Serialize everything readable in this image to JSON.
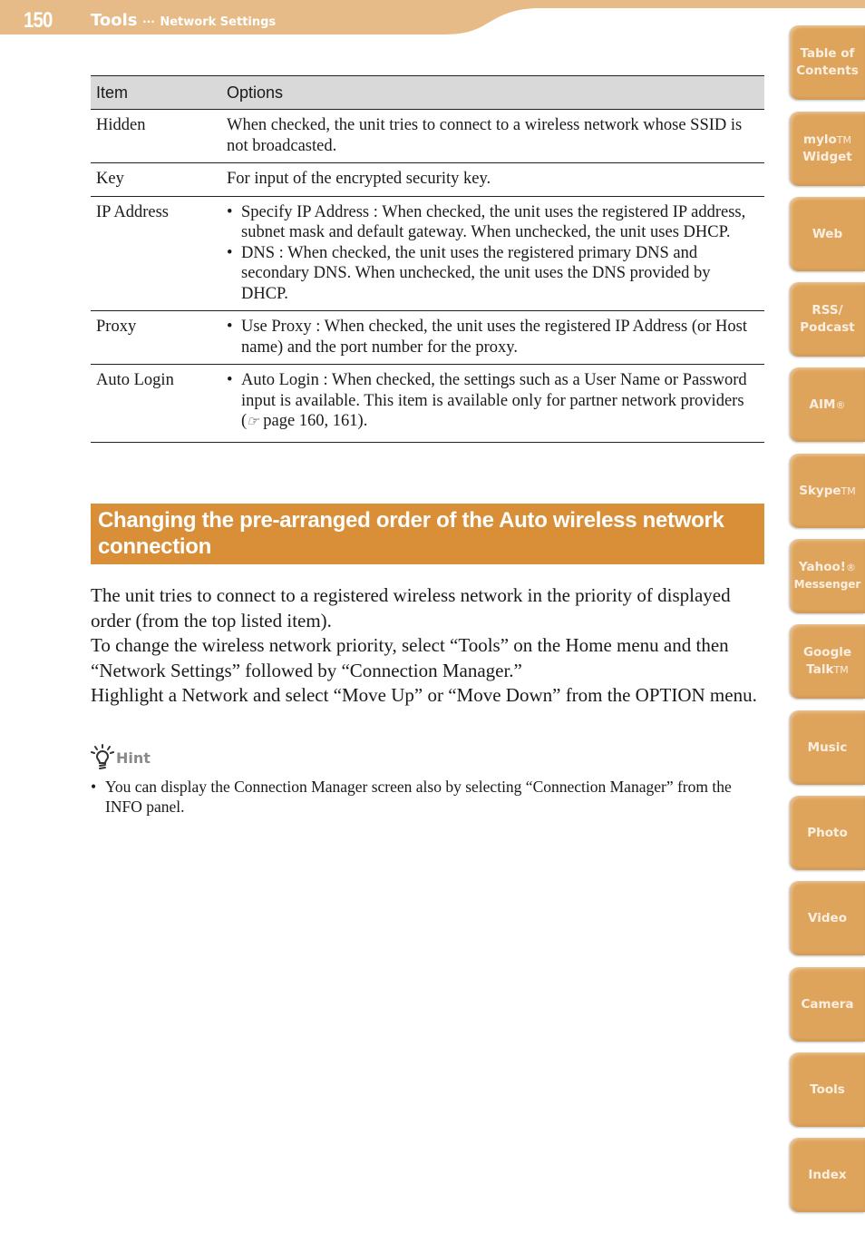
{
  "header": {
    "page_number": "150",
    "section": "Tools",
    "separator": "···",
    "subsection": "Network Settings"
  },
  "table": {
    "headers": [
      "Item",
      "Options"
    ],
    "rows": [
      {
        "item": "Hidden",
        "text": "When checked, the unit tries to connect to a wireless network whose SSID is not broadcasted."
      },
      {
        "item": "Key",
        "text": "For input of the encrypted security key."
      },
      {
        "item": "IP Address",
        "bullets": [
          "Specify IP Address : When checked, the unit uses the registered IP address, subnet mask and default gateway. When unchecked, the unit uses DHCP.",
          "DNS : When checked, the unit uses the registered primary DNS and secondary DNS. When unchecked, the unit uses the DNS provided by DHCP."
        ]
      },
      {
        "item": "Proxy",
        "bullets": [
          "Use Proxy : When checked, the unit uses the registered IP Address (or Host name) and the port number for the proxy."
        ]
      },
      {
        "item": "Auto Login",
        "bullet_prefix": "Auto Login : When checked, the settings such as a User Name or Password input is available. This item is available only for partner network providers (",
        "ref_icon": "☞",
        "bullet_suffix": " page 160, 161)."
      }
    ]
  },
  "section": {
    "title": "Changing the pre-arranged order of the Auto wireless network connection",
    "paragraphs": [
      "The unit tries to connect to a registered wireless network in the priority of displayed order (from the top listed item).",
      "To change the wireless network priority, select “Tools” on the Home menu and then “Network Settings” followed by “Connection Manager.”",
      "Highlight a Network and select “Move Up” or “Move Down” from the OPTION menu."
    ]
  },
  "hint": {
    "label": "Hint",
    "items": [
      "You can display the Connection Manager screen also by selecting “Connection Manager” from the INFO panel."
    ]
  },
  "sidebar": {
    "tabs": [
      {
        "line1": "Table of",
        "line2": "Contents"
      },
      {
        "line1": "mylo",
        "tm1": "TM",
        "line2": "Widget"
      },
      {
        "line1": "Web"
      },
      {
        "line1": "RSS/",
        "line2": "Podcast"
      },
      {
        "line1": "AIM",
        "tm1": "®"
      },
      {
        "line1": "Skype",
        "tm1": "TM"
      },
      {
        "line1": "Yahoo!",
        "tm1": "®",
        "line2": "Messenger"
      },
      {
        "line1": "Google",
        "line2": "Talk",
        "tm2": "TM"
      },
      {
        "line1": "Music"
      },
      {
        "line1": "Photo"
      },
      {
        "line1": "Video"
      },
      {
        "line1": "Camera"
      },
      {
        "line1": "Tools"
      },
      {
        "line1": "Index"
      }
    ]
  },
  "colors": {
    "header_band": "#e7bb87",
    "section_title_bg": "#d88f37",
    "tab_bg": "#dfa45c",
    "table_header_bg": "#d9d9d9"
  }
}
